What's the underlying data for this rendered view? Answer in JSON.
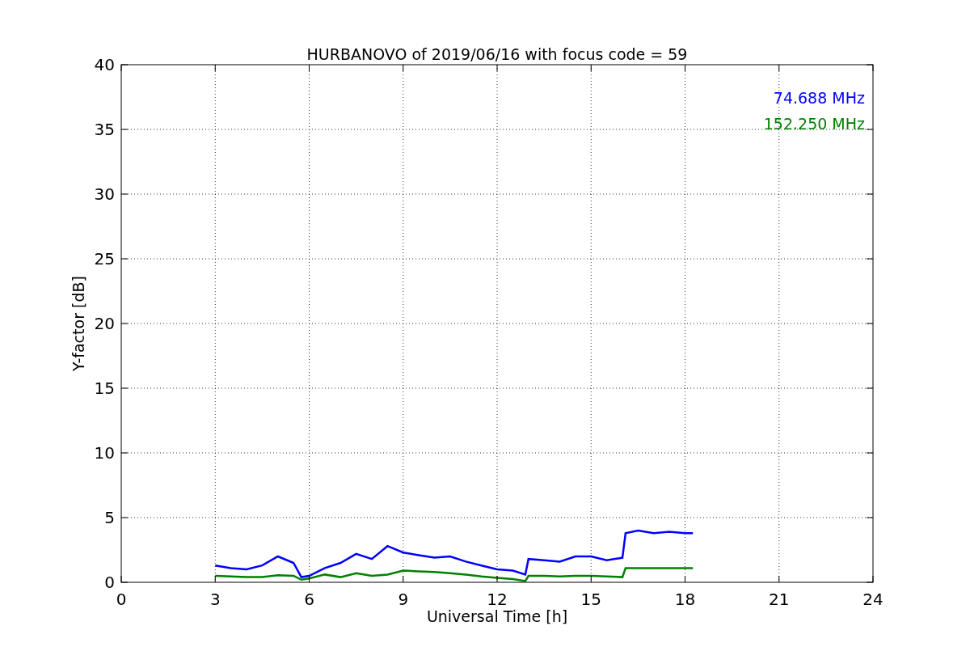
{
  "chart": {
    "chart_data": {
      "type": "line",
      "title": "HURBANOVO of 2019/06/16 with focus code = 59",
      "xlabel": "Universal Time [h]",
      "ylabel": "Y-factor [dB]",
      "x": [
        3,
        3.5,
        4,
        4.5,
        5,
        5.5,
        5.75,
        6,
        6.5,
        7,
        7.5,
        8,
        8.5,
        9,
        9.5,
        10,
        10.5,
        11,
        11.5,
        12,
        12.5,
        12.9,
        13,
        13.5,
        14,
        14.5,
        15,
        15.5,
        16,
        16.1,
        16.5,
        17,
        17.5,
        18,
        18.25
      ],
      "series": [
        {
          "name": "74.688 MHz",
          "color": "#0000ff",
          "values": [
            1.3,
            1.1,
            1.0,
            1.3,
            2.0,
            1.5,
            0.4,
            0.5,
            1.1,
            1.5,
            2.2,
            1.8,
            2.8,
            2.3,
            2.1,
            1.9,
            2.0,
            1.6,
            1.3,
            1.0,
            0.9,
            0.6,
            1.8,
            1.7,
            1.6,
            2.0,
            2.0,
            1.7,
            1.9,
            3.8,
            4.0,
            3.8,
            3.9,
            3.8,
            3.8
          ]
        },
        {
          "name": "152.250 MHz",
          "color": "#008000",
          "values": [
            0.5,
            0.45,
            0.4,
            0.4,
            0.55,
            0.5,
            0.2,
            0.3,
            0.6,
            0.4,
            0.7,
            0.5,
            0.6,
            0.9,
            0.85,
            0.8,
            0.7,
            0.6,
            0.45,
            0.35,
            0.25,
            0.1,
            0.5,
            0.5,
            0.45,
            0.5,
            0.5,
            0.45,
            0.4,
            1.1,
            1.1,
            1.1,
            1.1,
            1.1,
            1.1
          ]
        }
      ],
      "grid": true,
      "xlim": [
        0,
        24
      ],
      "ylim": [
        0,
        40
      ],
      "xticks": [
        0,
        3,
        6,
        9,
        12,
        15,
        18,
        21,
        24
      ],
      "yticks": [
        0,
        5,
        10,
        15,
        20,
        25,
        30,
        35,
        40
      ]
    }
  }
}
